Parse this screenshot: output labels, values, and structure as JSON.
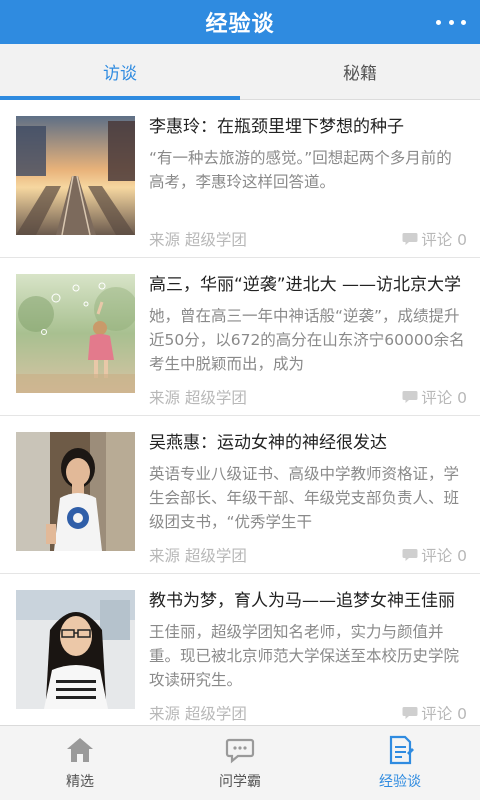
{
  "app_title": "经验谈",
  "colors": {
    "accent": "#2f8be0",
    "muted": "#8a8a8a"
  },
  "tabs": [
    {
      "label": "访谈",
      "active": true
    },
    {
      "label": "秘籍",
      "active": false
    }
  ],
  "articles": [
    {
      "title": "李惠玲：在瓶颈里埋下梦想的种子",
      "summary": "“有一种去旅游的感觉。”回想起两个多月前的高考，李惠玲这样回答道。",
      "source": "来源 超级学团",
      "comments": "评论 0",
      "thumb": "railway-sunset"
    },
    {
      "title": "高三，华丽“逆袭”进北大 ——访北京大学",
      "summary": "她，曾在高三一年中神话般“逆袭”，成绩提升近50分，以672的高分在山东济宁60000余名考生中脱颖而出，成为",
      "source": "来源 超级学团",
      "comments": "评论 0",
      "thumb": "girl-bubbles"
    },
    {
      "title": "吴燕惠：运动女神的神经很发达",
      "summary": "英语专业八级证书、高级中学教师资格证，学生会部长、年级干部、年级党支部负责人、班级团支书，“优秀学生干",
      "source": "来源 超级学团",
      "comments": "评论 0",
      "thumb": "woman-portrait"
    },
    {
      "title": "教书为梦，育人为马——追梦女神王佳丽",
      "summary": "王佳丽，超级学团知名老师，实力与颜值并重。现已被北京师范大学保送至本校历史学院攻读研究生。",
      "source": "来源 超级学团",
      "comments": "评论 0",
      "thumb": "woman-glasses"
    }
  ],
  "bottom_tabs": [
    {
      "label": "精选",
      "icon": "home-icon",
      "active": false
    },
    {
      "label": "问学霸",
      "icon": "chat-icon",
      "active": false
    },
    {
      "label": "经验谈",
      "icon": "document-icon",
      "active": true
    }
  ]
}
